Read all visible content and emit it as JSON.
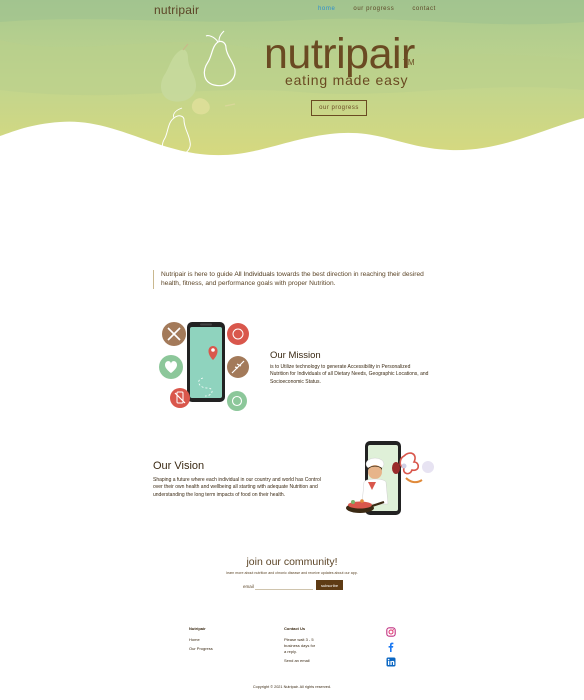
{
  "header": {
    "brand": "nutripair",
    "nav": [
      "home",
      "our progress",
      "contact"
    ],
    "active_nav": "home"
  },
  "hero": {
    "logo": "nutripair",
    "trademark": "TM",
    "tagline": "eating made easy",
    "button": "our progress"
  },
  "intro": {
    "before": "Nutripair is here to guide ",
    "highlight": "All Individuals",
    "after": " towards the best direction in reaching their desired health, fitness, and performance goals with proper Nutrition."
  },
  "mission": {
    "title": "Our Mission",
    "text": "is to Utilize technology to generate Accessibility in Personalized Nutrition for Individuals of all Dietary Needs, Geographic Locations, and Socioeconomic Status."
  },
  "vision": {
    "title": "Our Vision",
    "text": "Shaping a future where each individual in our country and world has Control over their own health and wellbeing all starting with adequate Nutrition and understanding the long term impacts of food on their health."
  },
  "community": {
    "title": "join our community!",
    "subtitle": "learn more about nutrition and chronic disease and receive updates about our app.",
    "email_label": "email",
    "subscribe": "subscribe"
  },
  "footer": {
    "col1_title": "Nutripair",
    "col1_links": [
      "Home",
      "Our Progress"
    ],
    "col2_title": "Contact Us",
    "col2_text": [
      "Please wait 3 - 5",
      "business days for",
      "a reply."
    ],
    "col2_action": "Send an email",
    "social_icons": [
      "instagram-icon",
      "facebook-icon",
      "linkedin-icon"
    ],
    "copyright": "Copyright © 2021 Nutripair.  All rights reserved."
  },
  "colors": {
    "hero_top": "#b5cf92",
    "hero_bottom": "#d4d886",
    "brown": "#6a4a22",
    "nav_active": "#2e8fcf",
    "subscribe_bg": "#5e3b14"
  }
}
